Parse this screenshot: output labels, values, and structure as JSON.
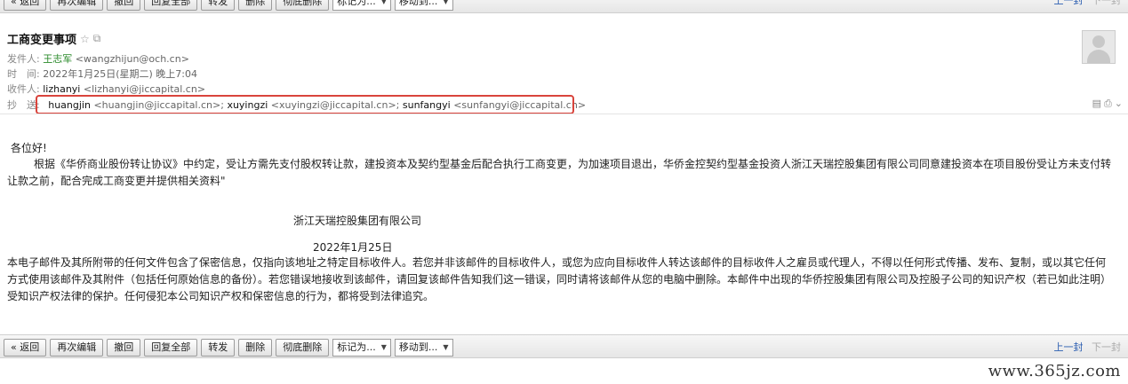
{
  "toolbar": {
    "buttons": [
      "« 返回",
      "再次编辑",
      "撤回",
      "回复全部",
      "转发",
      "删除",
      "彻底删除"
    ],
    "mark_as": "标记为...",
    "move_to": "移动到...",
    "prev": "上一封",
    "next": "下一封"
  },
  "mail": {
    "subject": "工商变更事项",
    "from": {
      "label": "发件人:",
      "name": "王志军",
      "addr": "<wangzhijun@och.cn>"
    },
    "time": {
      "label": "时　间:",
      "value": "2022年1月25日(星期二) 晚上7:04"
    },
    "to": {
      "label": "收件人:",
      "name": "lizhanyi",
      "addr": "<lizhanyi@jiccapital.cn>"
    },
    "cc": {
      "label": "抄　送:",
      "people": [
        {
          "name": "huangjin",
          "addr": "<huangjin@jiccapital.cn>;"
        },
        {
          "name": "xuyingzi",
          "addr": "<xuyingzi@jiccapital.cn>;"
        },
        {
          "name": "sunfangyi",
          "addr": "<sunfangyi@jiccapital.cn>"
        }
      ]
    }
  },
  "body": {
    "greeting": "各位好!",
    "paragraph": "根据《华侨商业股份转让协议》中约定，受让方需先支付股权转让款，建投资本及契约型基金后配合执行工商变更，为加速项目退出，华侨金控契约型基金投资人浙江天瑞控股集团有限公司同意建投资本在项目股份受让方未支付转让款之前，配合完成工商变更并提供相关资料\"",
    "company": "浙江天瑞控股集团有限公司",
    "date": "2022年1月25日",
    "disclaimer": "本电子邮件及其所附带的任何文件包含了保密信息，仅指向该地址之特定目标收件人。若您并非该邮件的目标收件人，或您为应向目标收件人转达该邮件的目标收件人之雇员或代理人，不得以任何形式传播、发布、复制，或以其它任何方式使用该邮件及其附件（包括任何原始信息的备份）。若您错误地接收到该邮件，请回复该邮件告知我们这一错误，同时请将该邮件从您的电脑中删除。本邮件中出现的华侨控股集团有限公司及控股子公司的知识产权（若已如此注明）受知识产权法律的保护。任何侵犯本公司知识产权和保密信息的行为，都将受到法律追究。"
  },
  "watermark": "www.365jz.com",
  "icons": [
    "star-icon",
    "popout-icon",
    "avatar-icon",
    "note-icon",
    "print-icon",
    "chevron-down-icon"
  ],
  "colors": {
    "highlight_border": "#d9443c",
    "sender_name": "#2a8a2a",
    "link": "#2a5db0"
  }
}
